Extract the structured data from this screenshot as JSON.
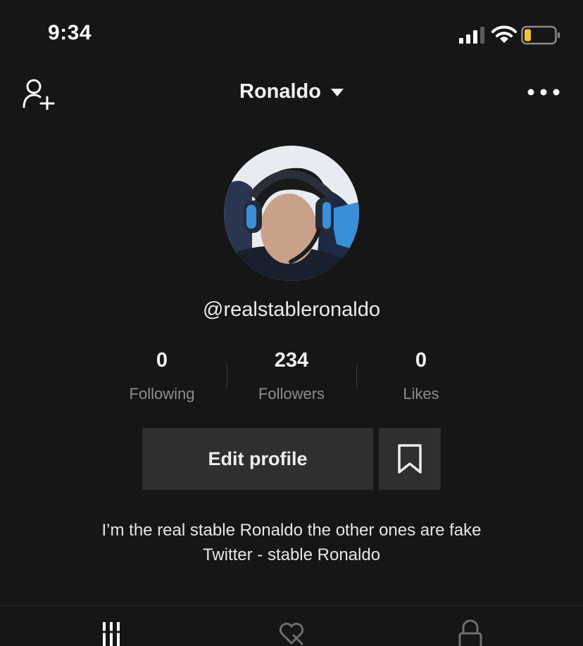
{
  "status_bar": {
    "time": "9:34",
    "icons": [
      "cellular-signal-icon",
      "wifi-icon",
      "battery-icon"
    ],
    "battery_color": "#f4c430"
  },
  "header": {
    "title": "Ronaldo",
    "left_icon": "add-user-icon",
    "right_icon": "more-options-icon"
  },
  "profile": {
    "handle": "@realstableronaldo",
    "stats": [
      {
        "value": "0",
        "label": "Following"
      },
      {
        "value": "234",
        "label": "Followers"
      },
      {
        "value": "0",
        "label": "Likes"
      }
    ],
    "edit_label": "Edit profile",
    "bookmark_icon": "bookmark-icon",
    "bio_lines": [
      "I’m the real stable Ronaldo the other ones are fake",
      "Twitter - stable Ronaldo"
    ]
  },
  "tabs": [
    {
      "icon": "videos-grid-icon",
      "active": true
    },
    {
      "icon": "liked-hidden-icon",
      "active": false
    },
    {
      "icon": "private-lock-icon",
      "active": false
    }
  ],
  "colors": {
    "background": "#161616",
    "button": "#2f2f2f",
    "muted_text": "#8d8d8d"
  }
}
